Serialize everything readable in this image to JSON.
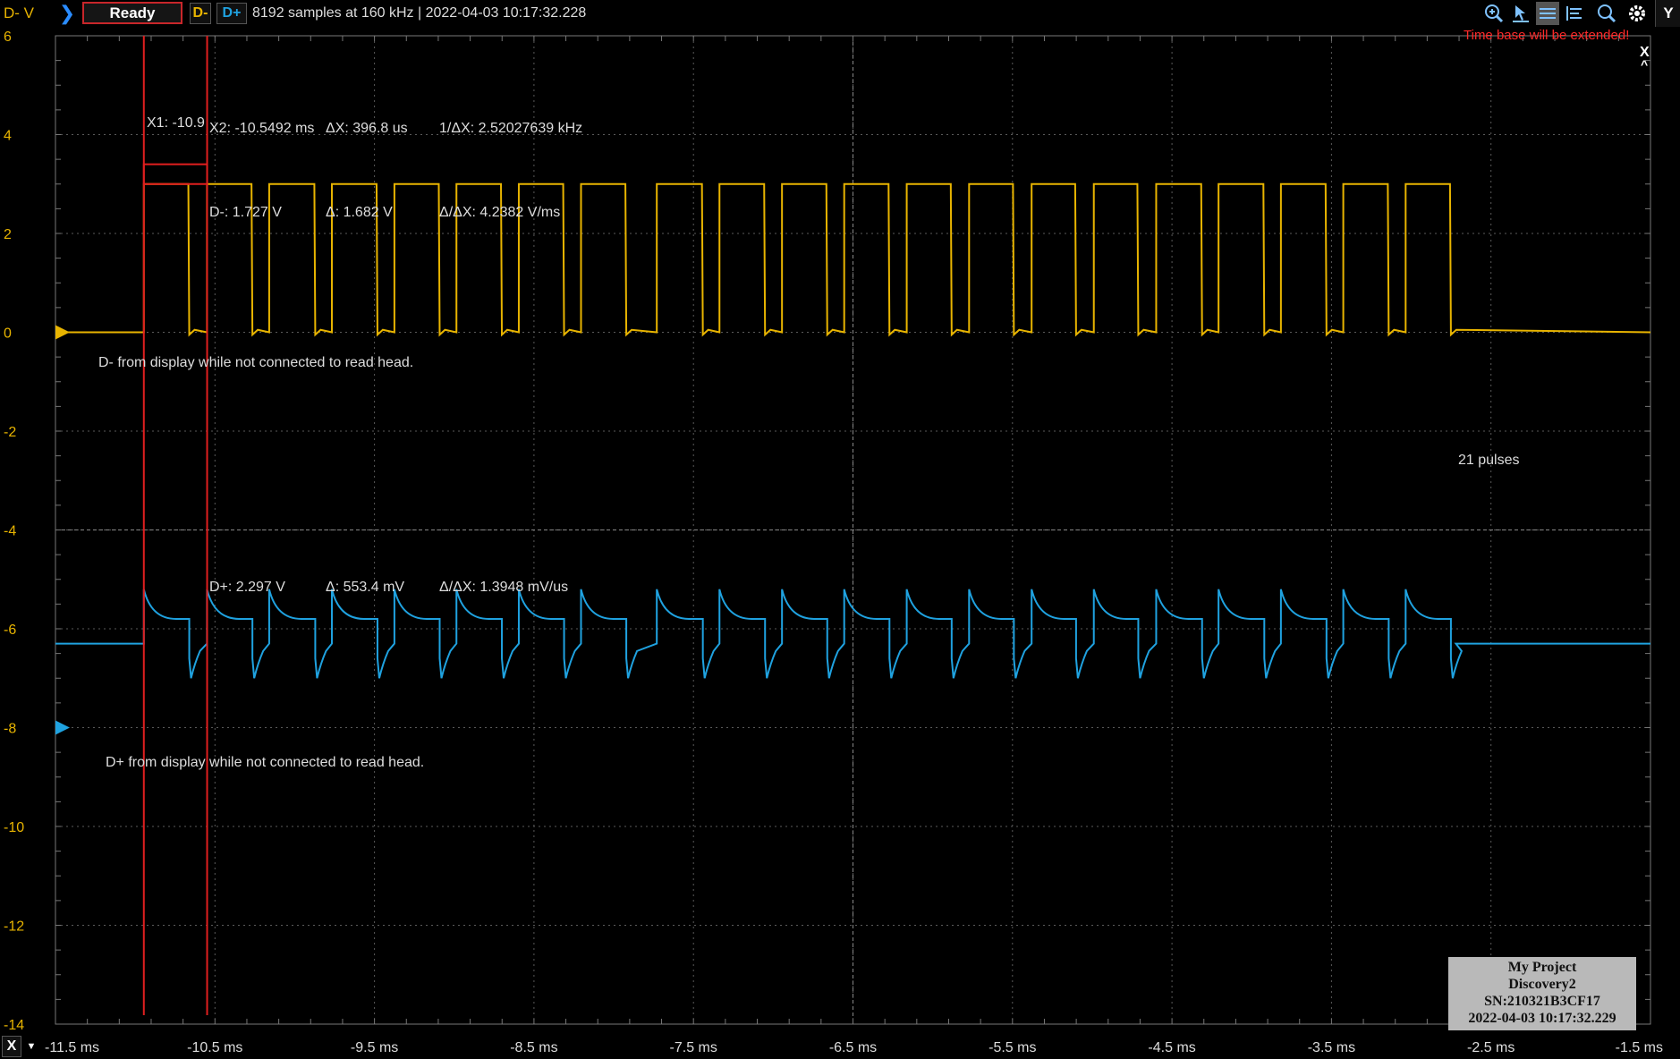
{
  "toolbar": {
    "units": "D- V",
    "status": "Ready",
    "channel1": "D-",
    "channel2": "D+",
    "acquisition_info": "8192 samples at 160 kHz | 2022-04-03 10:17:32.228",
    "tools": [
      "zoom-in-icon",
      "cursor-icon",
      "grid-icon",
      "list-icon",
      "zoom-icon",
      "gear-icon"
    ],
    "y_button": "Y",
    "x_button": "X"
  },
  "warning": "Time base will be extended!",
  "close_label": "X",
  "collapse_label": "^",
  "y_axis": {
    "ticks": [
      "6",
      "4",
      "2",
      "0",
      "-2",
      "-4",
      "-6",
      "-8",
      "-10",
      "-12",
      "-14"
    ]
  },
  "x_axis": {
    "ticks": [
      "-11.5 ms",
      "-10.5 ms",
      "-9.5 ms",
      "-8.5 ms",
      "-7.5 ms",
      "-6.5 ms",
      "-5.5 ms",
      "-4.5 ms",
      "-3.5 ms",
      "-2.5 ms",
      "-1.5 ms"
    ]
  },
  "cursors": {
    "x1_label": "X1: -10.9",
    "x2_label": "X2: -10.5492 ms",
    "dx_label": "ΔX: 396.8 us",
    "inv_dx_label": "1/ΔX: 2.52027639 kHz",
    "dminus_value": "D-: 1.727 V",
    "dminus_delta": "Δ: 1.682 V",
    "dminus_slope": "Δ/ΔX: 4.2382 V/ms",
    "dplus_value": "D+: 2.297 V",
    "dplus_delta": "Δ: 553.4 mV",
    "dplus_slope": "Δ/ΔX: 1.3948 mV/us"
  },
  "annotations": {
    "dminus_note": "D- from display while not connected to read head.",
    "dplus_note": "D+ from display while not connected to read head.",
    "pulse_count": "21 pulses"
  },
  "device": {
    "project": "My Project",
    "model": "Discovery2",
    "serial": "SN:210321B3CF17",
    "timestamp": "2022-04-03 10:17:32.229"
  },
  "colors": {
    "dminus": "#e8b400",
    "dplus": "#1fa2e0",
    "cursor": "#e01f1f",
    "grid": "#5a5a5a",
    "background": "#000000"
  },
  "chart_data": {
    "type": "line",
    "ylabel": "D- V",
    "ylim": [
      -14,
      6
    ],
    "xlim": [
      -11.5,
      -1.5
    ],
    "x_unit": "ms",
    "grid": true,
    "cursors_x_ms": [
      -10.946,
      -10.5492
    ],
    "series": [
      {
        "name": "D-",
        "baseline_v": 0,
        "high_v": 3.0,
        "pulses_ms": [
          [
            -10.946,
            -10.65
          ],
          [
            -10.55,
            -10.254
          ],
          [
            -10.16,
            -9.86
          ],
          [
            -9.767,
            -9.47
          ],
          [
            -9.375,
            -9.08
          ],
          [
            -8.986,
            -8.69
          ],
          [
            -8.595,
            -8.3
          ],
          [
            -8.205,
            -7.91
          ],
          [
            -7.73,
            -7.43
          ],
          [
            -7.337,
            -7.04
          ],
          [
            -6.945,
            -6.65
          ],
          [
            -6.555,
            -6.26
          ],
          [
            -6.163,
            -5.87
          ],
          [
            -5.772,
            -5.48
          ],
          [
            -5.38,
            -5.09
          ],
          [
            -4.99,
            -4.7
          ],
          [
            -4.599,
            -4.3
          ],
          [
            -4.208,
            -3.91
          ],
          [
            -3.817,
            -3.52
          ],
          [
            -3.426,
            -3.13
          ],
          [
            -3.035,
            -2.74
          ]
        ]
      },
      {
        "name": "D+",
        "baseline_v": -6.3,
        "rest_v": -5.8,
        "peak_v": -5.2,
        "dip_v": -7.0
      }
    ]
  }
}
